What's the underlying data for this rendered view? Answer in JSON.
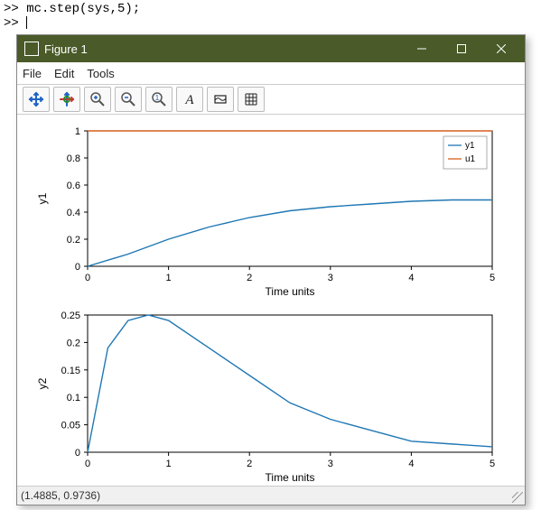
{
  "console": {
    "line1": ">> mc.step(sys,5);",
    "line2": ">> "
  },
  "window": {
    "title": "Figure 1"
  },
  "menu": {
    "file": "File",
    "edit": "Edit",
    "tools": "Tools"
  },
  "status": {
    "coords": "(1.4885, 0.9736)"
  },
  "chart_data": [
    {
      "type": "line",
      "title": "",
      "xlabel": "Time units",
      "ylabel": "y1",
      "xlim": [
        0,
        5
      ],
      "ylim": [
        0,
        1
      ],
      "xticks": [
        0,
        1,
        2,
        3,
        4,
        5
      ],
      "yticks": [
        0,
        0.2,
        0.4,
        0.6,
        0.8,
        1
      ],
      "legend": [
        "y1",
        "u1"
      ],
      "series": [
        {
          "name": "y1",
          "x": [
            0,
            0.5,
            1.0,
            1.5,
            2.0,
            2.5,
            3.0,
            3.5,
            4.0,
            4.5,
            5.0
          ],
          "y": [
            0.0,
            0.09,
            0.2,
            0.29,
            0.36,
            0.41,
            0.44,
            0.46,
            0.48,
            0.49,
            0.49
          ],
          "color": "#1f77b4"
        },
        {
          "name": "u1",
          "x": [
            0,
            5
          ],
          "y": [
            1.0,
            1.0
          ],
          "color": "#d65f1e"
        }
      ]
    },
    {
      "type": "line",
      "title": "",
      "xlabel": "Time units",
      "ylabel": "y2",
      "xlim": [
        0,
        5
      ],
      "ylim": [
        0,
        0.25
      ],
      "xticks": [
        0,
        1,
        2,
        3,
        4,
        5
      ],
      "yticks": [
        0,
        0.05,
        0.1,
        0.15,
        0.2,
        0.25
      ],
      "series": [
        {
          "name": "y2",
          "x": [
            0,
            0.25,
            0.5,
            0.75,
            1.0,
            1.5,
            2.0,
            2.5,
            3.0,
            3.5,
            4.0,
            4.5,
            5.0
          ],
          "y": [
            0.0,
            0.19,
            0.24,
            0.25,
            0.24,
            0.19,
            0.14,
            0.09,
            0.06,
            0.04,
            0.02,
            0.015,
            0.01
          ],
          "color": "#1f77b4"
        }
      ]
    }
  ]
}
